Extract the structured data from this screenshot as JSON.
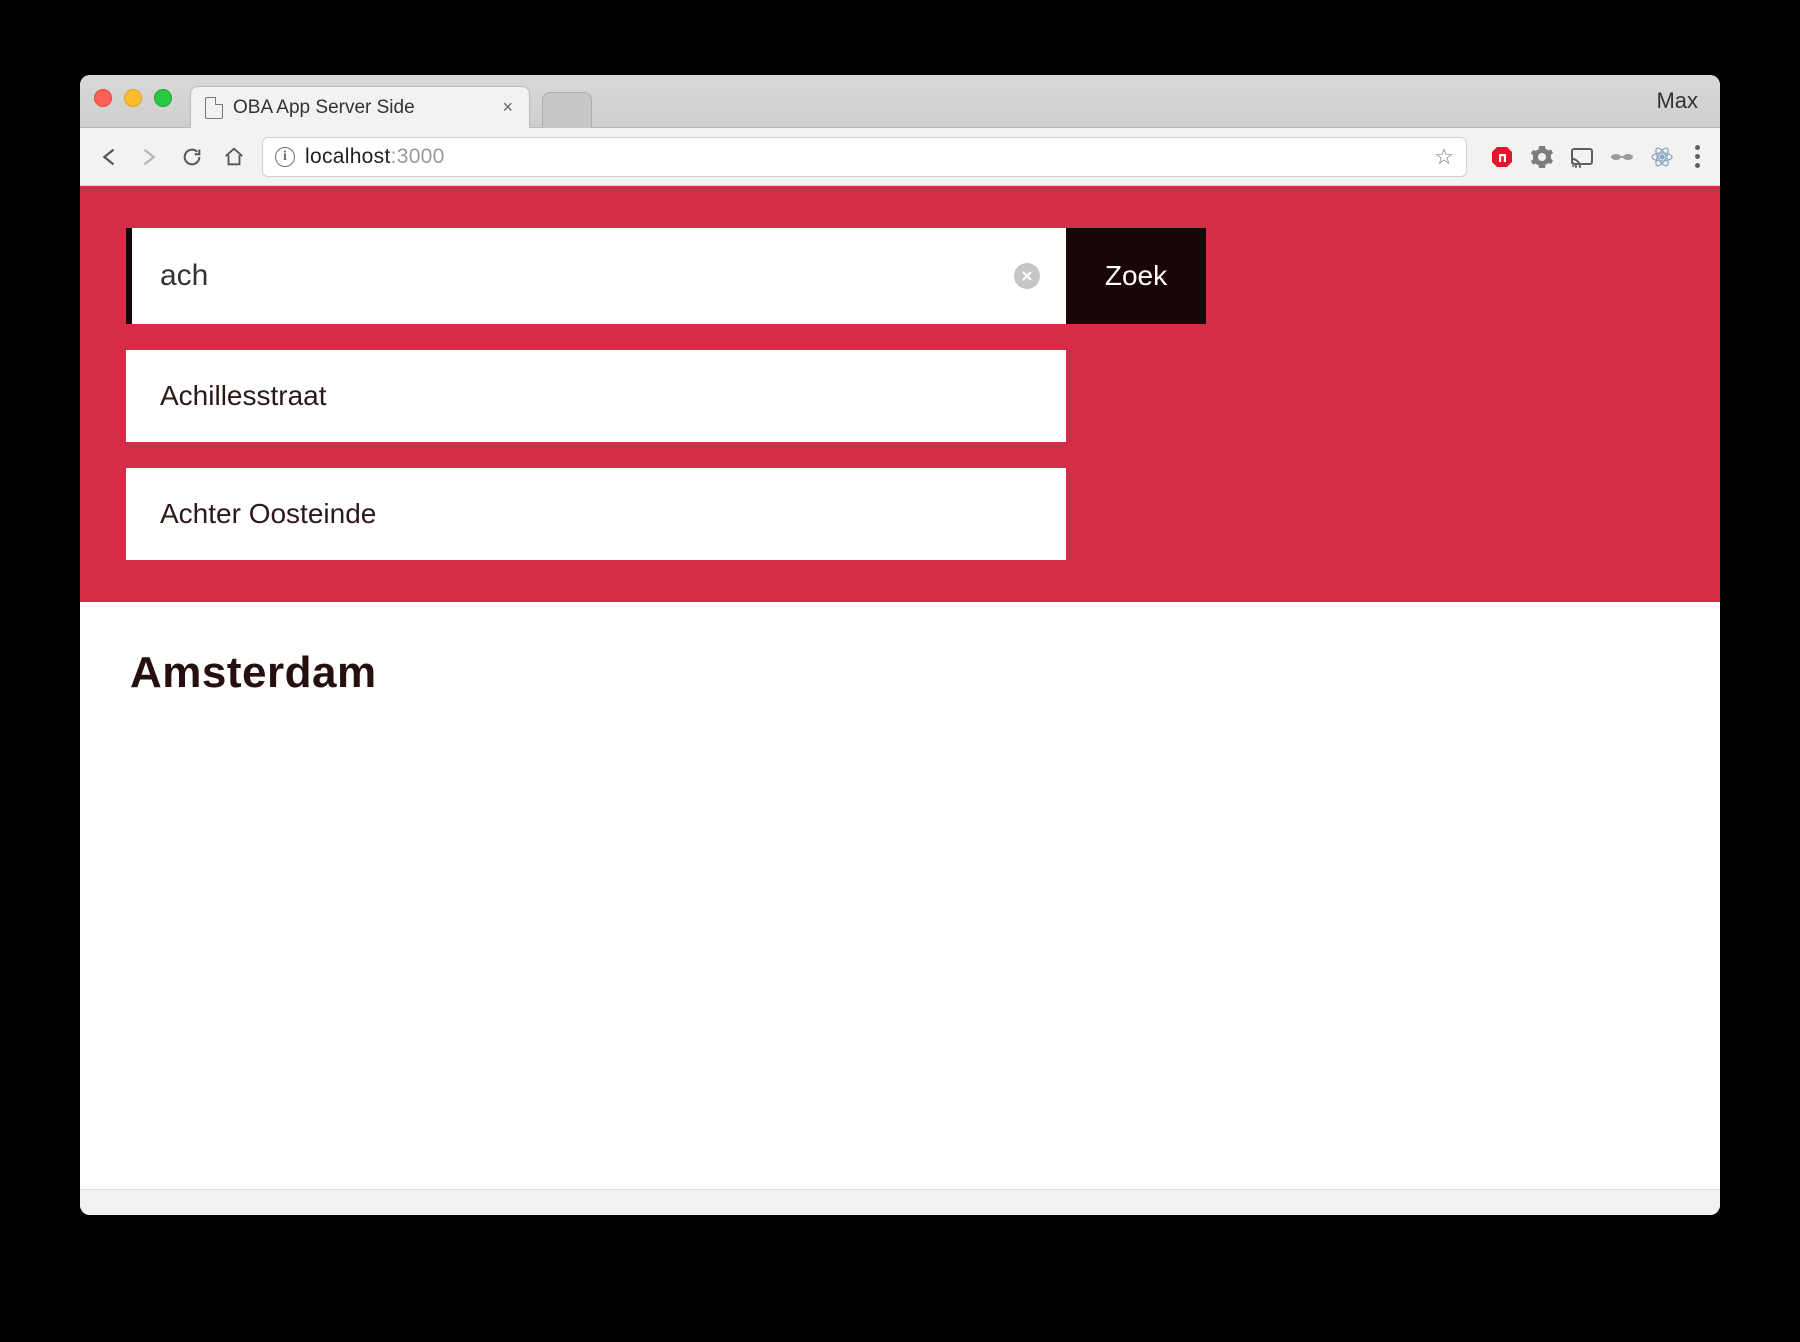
{
  "browser": {
    "tab_title": "OBA App Server Side",
    "profile": "Max",
    "address_host": "localhost",
    "address_port": ":3000"
  },
  "search": {
    "value": "ach",
    "button_label": "Zoek",
    "suggestions": [
      "Achillesstraat",
      "Achter Oosteinde"
    ]
  },
  "page": {
    "heading": "Amsterdam"
  }
}
